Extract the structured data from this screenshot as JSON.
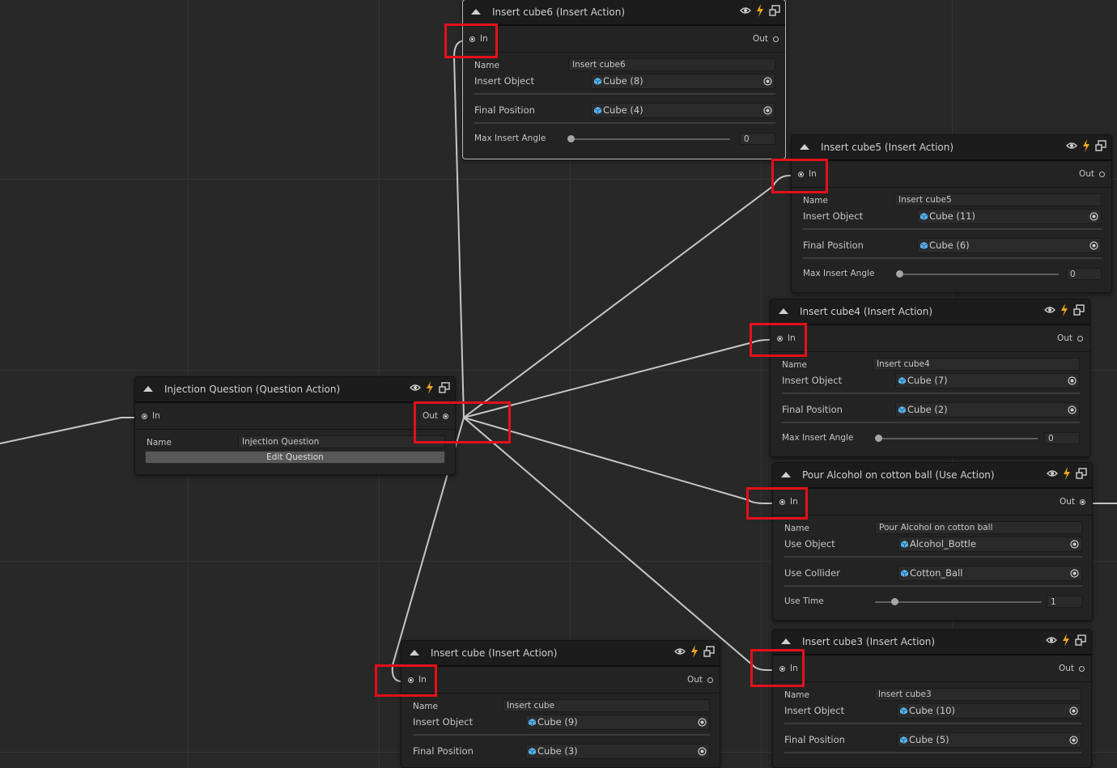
{
  "question_node": {
    "title": "Injection Question (Question Action)",
    "in_label": "In",
    "out_label": "Out",
    "name_label": "Name",
    "name_value": "Injection Question",
    "edit_button": "Edit Question"
  },
  "cube6_node": {
    "title": "Insert cube6 (Insert Action)",
    "in_label": "In",
    "out_label": "Out",
    "name_label": "Name",
    "name_value": "Insert cube6",
    "insert_object_label": "Insert Object",
    "insert_object_value": "Cube (8)",
    "final_position_label": "Final Position",
    "final_position_value": "Cube (4)",
    "angle_label": "Max Insert Angle",
    "angle_value": "0"
  },
  "cube5_node": {
    "title": "Insert cube5 (Insert Action)",
    "in_label": "In",
    "out_label": "Out",
    "name_label": "Name",
    "name_value": "Insert cube5",
    "insert_object_label": "Insert Object",
    "insert_object_value": "Cube (11)",
    "final_position_label": "Final Position",
    "final_position_value": "Cube (6)",
    "angle_label": "Max Insert Angle",
    "angle_value": "0"
  },
  "cube4_node": {
    "title": "Insert cube4 (Insert Action)",
    "in_label": "In",
    "out_label": "Out",
    "name_label": "Name",
    "name_value": "Insert cube4",
    "insert_object_label": "Insert Object",
    "insert_object_value": "Cube (7)",
    "final_position_label": "Final Position",
    "final_position_value": "Cube (2)",
    "angle_label": "Max Insert Angle",
    "angle_value": "0"
  },
  "pour_node": {
    "title": "Pour Alcohol on cotton ball (Use Action)",
    "in_label": "In",
    "out_label": "Out",
    "name_label": "Name",
    "name_value": "Pour Alcohol on cotton ball",
    "use_object_label": "Use Object",
    "use_object_value": "Alcohol_Bottle",
    "use_collider_label": "Use Collider",
    "use_collider_value": "Cotton_Ball",
    "use_time_label": "Use Time",
    "use_time_value": "1"
  },
  "cube3_node": {
    "title": "Insert cube3 (Insert Action)",
    "in_label": "In",
    "out_label": "Out",
    "name_label": "Name",
    "name_value": "Insert cube3",
    "insert_object_label": "Insert Object",
    "insert_object_value": "Cube (10)",
    "final_position_label": "Final Position",
    "final_position_value": "Cube (5)"
  },
  "cube_node": {
    "title": "Insert cube (Insert Action)",
    "in_label": "In",
    "out_label": "Out",
    "name_label": "Name",
    "name_value": "Insert cube",
    "insert_object_label": "Insert Object",
    "insert_object_value": "Cube (9)",
    "final_position_label": "Final Position",
    "final_position_value": "Cube (3)"
  },
  "colors": {
    "canvas": "#282828",
    "node": "#232323",
    "header": "#1c1c1c",
    "highlight": "#e3101a",
    "lightning": "#f0a31c",
    "cube_icon": "#5ab0e8",
    "edge": "#c8c8c8"
  }
}
